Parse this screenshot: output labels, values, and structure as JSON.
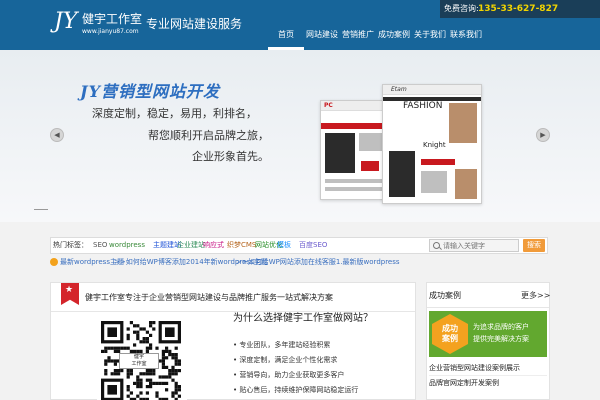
{
  "header": {
    "logo_mark": "JY",
    "logo_name": "健宇工作室",
    "logo_domain": "www.jianyu87.com",
    "tagline": "专业网站建设服务",
    "hotline_label": "免费咨询:",
    "hotline_number": "135-33-627-827",
    "nav": [
      "首页",
      "网站建设",
      "营销推广",
      "成功案例",
      "关于我们",
      "联系我们"
    ],
    "nav_active_index": 0,
    "colors": {
      "header_bg": "#17659a",
      "hotline_number": "#f2d400"
    }
  },
  "banner": {
    "title": "JY营销型网站开发",
    "line1": "深度定制，稳定，易用，利排名，",
    "line2": "帮您顺利开启品牌之旅，",
    "line3": "企业形象首先。",
    "prev_icon": "arrow-left-icon",
    "next_icon": "arrow-right-icon",
    "shot1_label": "PC",
    "shot2_label": "Etam",
    "shot2_heading": "FASHION",
    "shot2_sub": "Knight"
  },
  "tagbar": {
    "label": "热门标签：",
    "tags": [
      {
        "text": "SEO",
        "color": "#555555"
      },
      {
        "text": "wordpress",
        "color": "#3a8a3a"
      },
      {
        "text": "主题建站",
        "color": "#1a4fd6"
      },
      {
        "text": "企业建站",
        "color": "#2e8b57"
      },
      {
        "text": "响应式",
        "color": "#c71585"
      },
      {
        "text": "织梦CMS",
        "color": "#b5651d"
      },
      {
        "text": "网站优化",
        "color": "#228b22"
      },
      {
        "text": "模板",
        "color": "#1e90ff"
      },
      {
        "text": "百度SEO",
        "color": "#6a5acd"
      }
    ],
    "search_placeholder": "请输入关键字",
    "search_button": "搜索"
  },
  "ticker": {
    "items": [
      "最新wordpress主题",
      ">>如何给WP博客添加2014年新wordpress主题",
      ">>如何给WP网站添加在线客服1.最新版wordpress"
    ]
  },
  "main": {
    "title": "健宇工作室专注于企业营销型网站建设与品牌推广服务一站式解决方案",
    "subtitle": "为什么选择健宇工作室做网站？",
    "qr_caption_line1": "健宇",
    "qr_caption_line2": "工作室",
    "bullets": [
      "• 专业团队，多年建站经验积累",
      "• 深度定制，满足企业个性化需求",
      "• 营销导向，助力企业获取更多客户",
      "• 贴心售后，持续维护保障网站稳定运行"
    ]
  },
  "sidebar": {
    "title": "成功案例",
    "more": "更多>>",
    "case_badge_line1": "成功",
    "case_badge_line2": "案例",
    "case_line1": "为追求品牌的客户",
    "case_line2": "提供完美解决方案",
    "links": [
      "企业营销型网站建设案例展示",
      "品牌官网定制开发案例"
    ]
  }
}
